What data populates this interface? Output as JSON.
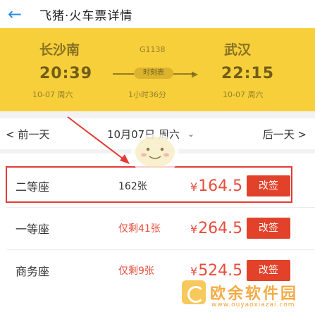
{
  "header": {
    "title": "飞猪·火车票详情"
  },
  "trip": {
    "from_station": "长沙南",
    "to_station": "武汉",
    "depart_time": "20:39",
    "arrive_time": "22:15",
    "train_no": "G1138",
    "depart_date": "10-07 周六",
    "arrive_date": "10-07 周六",
    "duration": "1小时36分",
    "schedule_label": "时刻表"
  },
  "date_nav": {
    "prev": "< 前一天",
    "current": "10月07日 周六",
    "next": "后一天 >"
  },
  "seats": [
    {
      "type": "二等座",
      "remain": "162张",
      "price": "164.5",
      "book": "改签"
    },
    {
      "type": "一等座",
      "remain": "仅剩41张",
      "price": "264.5",
      "book": "改签"
    },
    {
      "type": "商务座",
      "remain": "仅剩9张",
      "price": "524.5",
      "book": "改签"
    }
  ],
  "currency": "¥",
  "watermark": {
    "text": "欧余软件园",
    "sub": "www.ouyaoxiazai.com"
  },
  "colors": {
    "accent": "#2c8ce9",
    "hero": "#f7cf3b",
    "price": "#e74c3c",
    "button": "#e2422a",
    "highlight": "#e23b35"
  }
}
